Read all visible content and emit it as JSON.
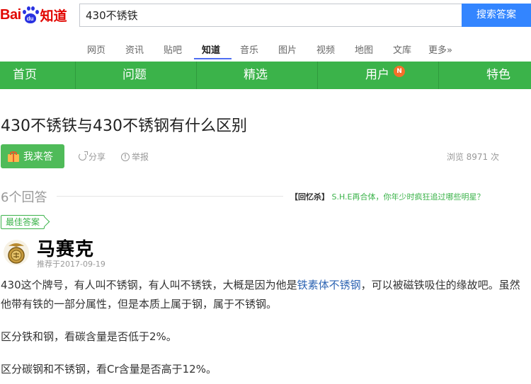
{
  "header": {
    "logo_bai": "Bai",
    "logo_du": "du",
    "logo_zhidao": "知道",
    "search_value": "430不锈铁",
    "search_button": "搜索答案"
  },
  "topnav": {
    "items": [
      "网页",
      "资讯",
      "贴吧",
      "知道",
      "音乐",
      "图片",
      "视频",
      "地图",
      "文库",
      "更多»"
    ],
    "active": "知道"
  },
  "greenbar": {
    "items": [
      "首页",
      "问题",
      "精选",
      "用户",
      "特色"
    ],
    "badge": "N",
    "color": "#3bb34a",
    "badge_color": "#f5702a"
  },
  "question": {
    "title": "430不锈铁与430不锈钢有什么区别",
    "answer_button": "我来答",
    "share": "分享",
    "report": "举报",
    "views": "浏览 8971 次"
  },
  "answers": {
    "count": "6个回答",
    "promo_tag": "【回忆杀】",
    "promo_text": "S.H.E再合体，你年少时疯狂追过哪些明星？",
    "best_label": "最佳答案",
    "user": "马赛克",
    "rec_date": "推荐于2017-09-19",
    "p1_before": "430这个牌号，有人叫不锈钢，有人叫不锈铁，大概是因为他是",
    "p1_link": "铁素体不锈钢",
    "p1_after": "，可以被磁铁吸住的缘故吧。虽然他带有铁的一部分属性，但是本质上属于钢，属于不锈钢。",
    "p2": "区分铁和钢，看碳含量是否低于2%。",
    "p3": "区分碳钢和不锈钢，看Cr含量是否高于12%。"
  }
}
